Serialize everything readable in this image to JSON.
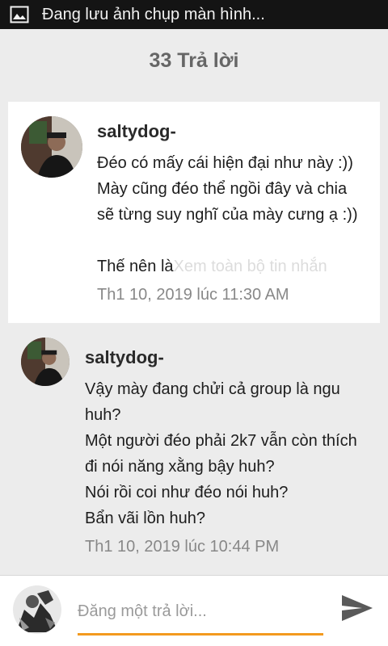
{
  "status_bar": {
    "text": "Đang lưu ảnh chụp màn hình...",
    "icon": "image-icon"
  },
  "header": {
    "title": "33 Trả lời"
  },
  "comments": [
    {
      "username": "saltydog-",
      "lines": [
        "Đéo có mấy cái hiện đại như này :))",
        "Mày cũng đéo thể ngồi đây và chia",
        "sẽ từng suy nghĩ của mày cưng ạ :))",
        "",
        "Thế nên là"
      ],
      "see_more": "Xem toàn bộ tin nhắn",
      "timestamp": "Th1 10, 2019 lúc 11:30 AM"
    },
    {
      "username": "saltydog-",
      "lines": [
        "Vậy mày đang chửi cả group là ngu",
        "huh?",
        "Một người đéo phải 2k7 vẫn còn thích",
        "đi nói năng xằng bậy huh?",
        "Nói rồi coi như đéo nói huh?",
        "Bẩn vãi lồn huh?"
      ],
      "timestamp": "Th1 10, 2019 lúc 10:44 PM"
    }
  ],
  "compose": {
    "placeholder": "Đăng một trả lời...",
    "send_icon": "send-icon"
  },
  "colors": {
    "accent": "#f39a1e",
    "status_bar": "#141414",
    "background": "#ececec"
  }
}
